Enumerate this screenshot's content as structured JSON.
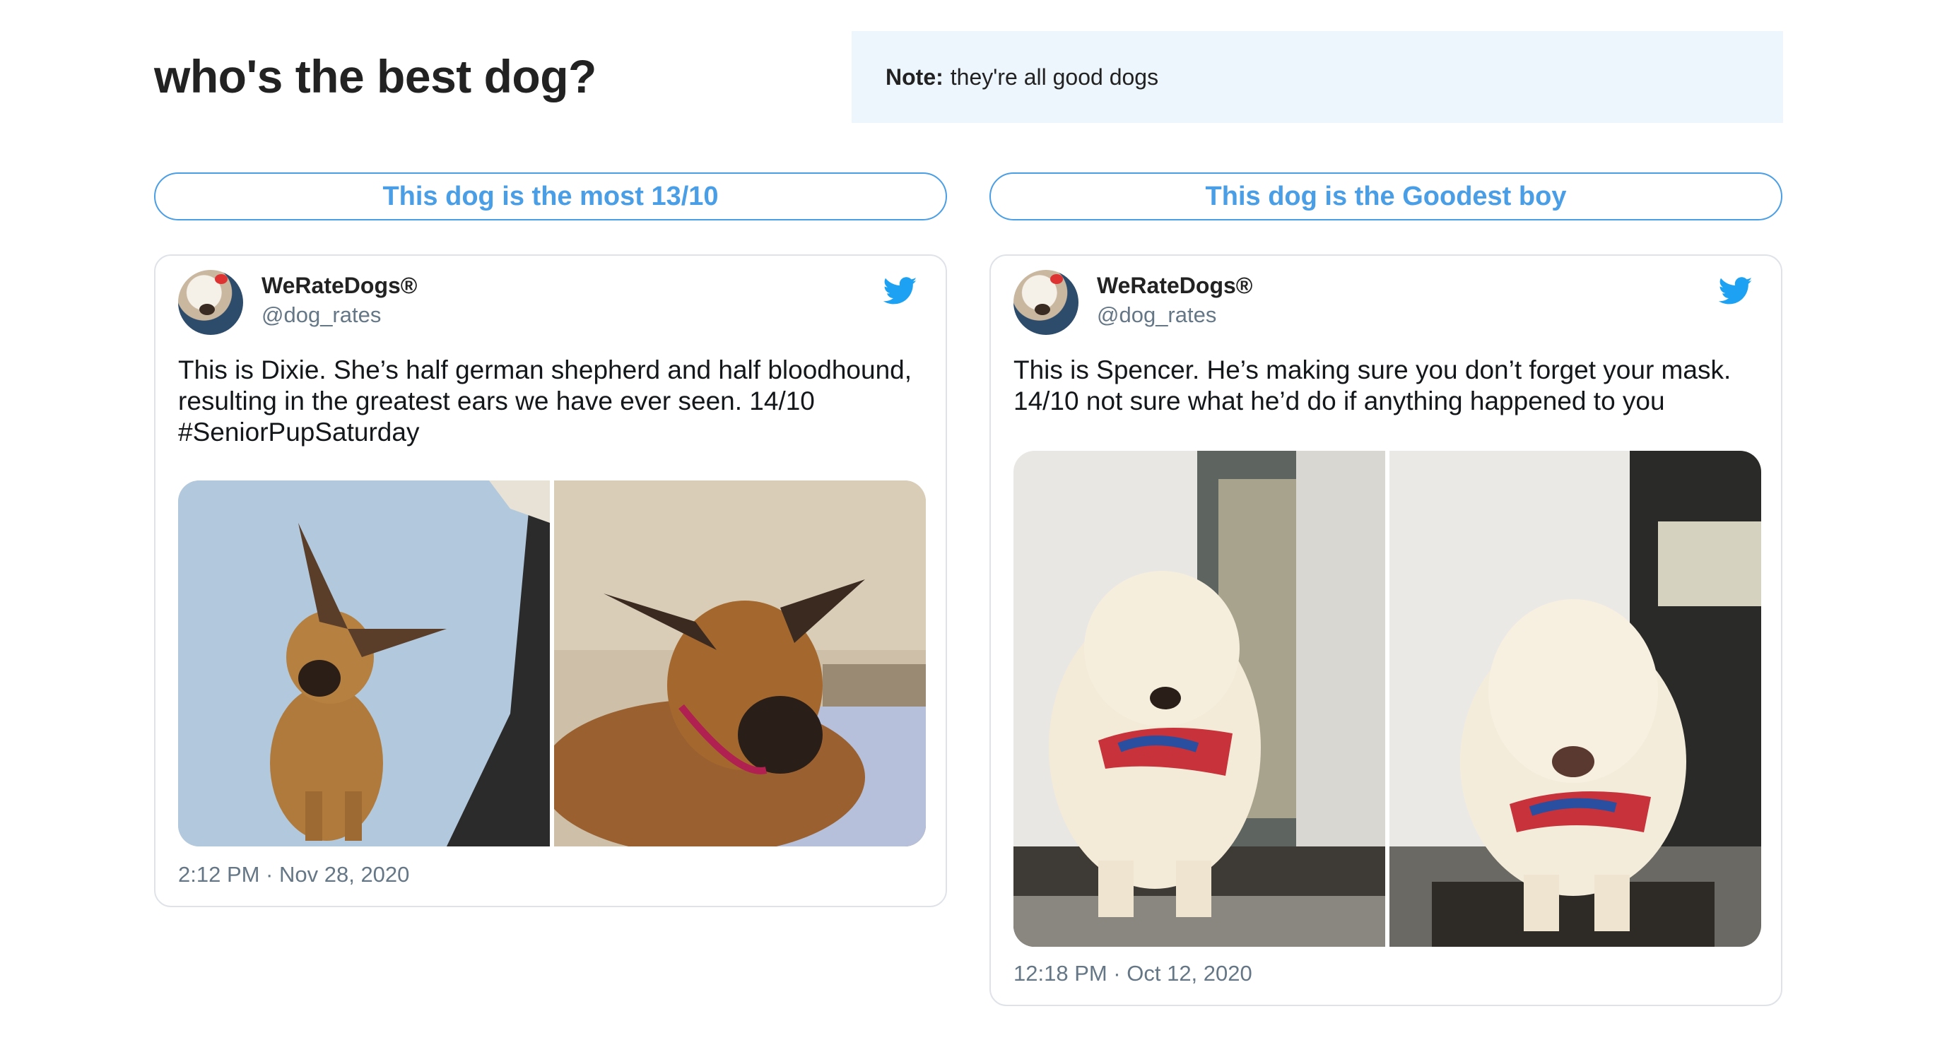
{
  "header": {
    "title": "who's the best dog?",
    "note_label": "Note:",
    "note_text": "they're all good dogs"
  },
  "options": [
    {
      "vote_label": "This dog is the most 13/10",
      "tweet": {
        "author_name": "WeRateDogs®",
        "author_handle": "@dog_rates",
        "text": "This is Dixie. She’s half german shepherd and half bloodhound, resulting in the greatest ears we have ever seen. 14/10 #SeniorPupSaturday",
        "time": "2:12 PM · Nov 28, 2020",
        "photos": [
          "dog-photo-dixie-sitting",
          "dog-photo-dixie-lying"
        ]
      }
    },
    {
      "vote_label": "This dog is the Goodest boy",
      "tweet": {
        "author_name": "WeRateDogs®",
        "author_handle": "@dog_rates",
        "text": "This is Spencer. He’s making sure you don’t forget your mask. 14/10 not sure what he’d do if anything happened to you",
        "time": "12:18 PM · Oct 12, 2020",
        "photos": [
          "dog-photo-spencer-mask-1",
          "dog-photo-spencer-mask-2"
        ]
      }
    }
  ],
  "colors": {
    "accent": "#4a9ee6",
    "note_bg": "#edf5fd",
    "card_border": "#dfe3e8",
    "muted_text": "#657786"
  },
  "icons": [
    "twitter-bird-icon"
  ]
}
